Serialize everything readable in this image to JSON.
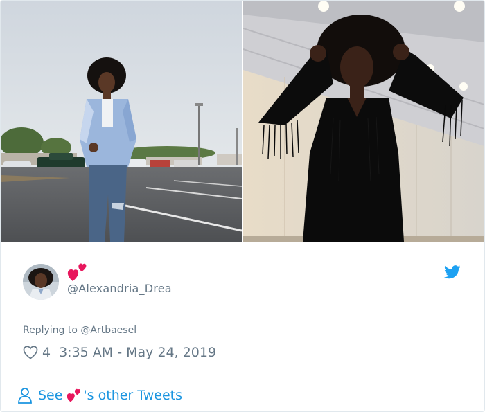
{
  "tweet": {
    "display_name_emoji": "two-hearts-emoji",
    "handle": "@Alexandria_Drea",
    "reply_prefix": "Replying to ",
    "reply_mention": "@Artbaesel",
    "like_count": "4",
    "timestamp": "3:35 AM - May 24, 2019",
    "footer_see": "See",
    "footer_rest": "'s other Tweets"
  },
  "colors": {
    "accent": "#1b95e0",
    "muted": "#657786",
    "border": "#e1e8ed",
    "heart": "#e8175d"
  },
  "icons": {
    "bird": "twitter-bird-icon",
    "like": "heart-outline-icon",
    "person": "person-icon"
  }
}
